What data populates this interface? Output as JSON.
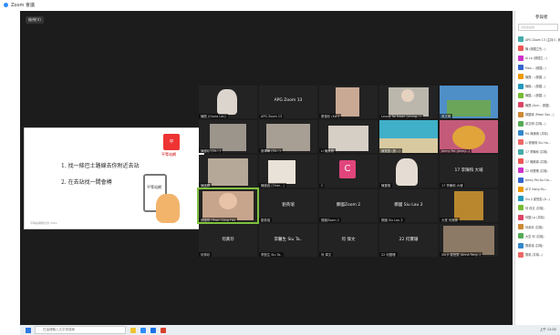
{
  "window": {
    "title": "Zoom 會議"
  },
  "meeting": {
    "view_button": "檢視(V)"
  },
  "share": {
    "lines": [
      "1. 找一條巴士路線去你附近去站",
      "2. 在去站找一間會樽"
    ],
    "logo_text": "平等站網",
    "phone_text": "平等站網",
    "footer": "平等站網聯合會 2022"
  },
  "tiles": [
    {
      "name": "陳觀 (Gloria Lau)",
      "label": ""
    },
    {
      "name": "APG Zoom 13",
      "label": "APG Zoom 13"
    },
    {
      "name": "蔡德珍 (Ka..)",
      "label": ""
    },
    {
      "name": "Leung Tai Kwan (Leung...)",
      "label": ""
    },
    {
      "name": "黃文明",
      "label": ""
    },
    {
      "name": "陳穗珍 (Ch...)",
      "label": ""
    },
    {
      "name": "鄭澤華 (Ch...)",
      "label": ""
    },
    {
      "name": "Li 陳美珠",
      "label": ""
    },
    {
      "name": "陳雪蓮 (麗...)",
      "label": ""
    },
    {
      "name": "Jenny Pal (Jenny...)",
      "label": ""
    },
    {
      "name": "陳國輝",
      "label": ""
    },
    {
      "name": "陳錦強 (Chan...)",
      "label": ""
    },
    {
      "name": "C",
      "label": "C"
    },
    {
      "name": "陳寶娟",
      "label": ""
    },
    {
      "name": "17 李陳和 大埔",
      "label": "17 李陳和 大埔"
    },
    {
      "name": "鄭國球 (Pawn Sang Ho)",
      "label": ""
    },
    {
      "name": "劉英瑞",
      "label": "劉英瑞"
    },
    {
      "name": "鄭國Zoom 2",
      "label": "鄭國Zoom 2"
    },
    {
      "name": "鄭國 Siu Lau 2",
      "label": "鄭國 Siu Lau 2"
    },
    {
      "name": "大堂 何美珠",
      "label": ""
    },
    {
      "name": "何黃珍",
      "label": "何黃珍"
    },
    {
      "name": "李醫生 Siu Ta..",
      "label": "李醫生 Siu Ta.."
    },
    {
      "name": "何 偉文",
      "label": "何 偉文"
    },
    {
      "name": "22 何寶珊",
      "label": "22 何寶珊"
    },
    {
      "name": "Siu Ji 梁慧雯 (Anna Tang..)",
      "label": ""
    }
  ],
  "panel": {
    "title": "參與者",
    "search_placeholder": "尋找參與者",
    "participants": [
      "APG Zoom 13 (主持人, 我)",
      "陳 (鄭國立先...)",
      "Ai Lo (鄭國立...)",
      "Man... (鄭國...)",
      "陳寶... (鄭國...)",
      "陳錦... (鄭國...)",
      "陳國... (鄭國...)",
      "陳寶 (Ann... 鄭國)",
      "鄭國球 (Pawn San...)",
      "黃文明 (共鳴...)",
      "ML 陳美珠 (共鳴)",
      "Li 鄭美珠 Siu Ha...",
      "17 李陳和 (共鳴)",
      "17 陳樂娟 (共鳴)",
      "22 何寶珊 (共鳴)",
      "Jenny Pal Siu Ha...",
      "ATZ Hong Siu...",
      "Siu Ji 梁慧雯 (A...)",
      "何 偉文 (共鳴)",
      "何國 Lo (共鳴)",
      "何黃珍 (共鳴)",
      "大堂 何 (共鳴)",
      "劉英瑞 (共鳴)",
      "劉英 (共鳴...)"
    ],
    "invite_label": "邀請",
    "mute_all_label": "全部"
  },
  "taskbar": {
    "search_placeholder": "在這裡輸入文字來搜尋",
    "clock": "上午 11:02"
  },
  "colors": {
    "meeting_bg": "#1c1c1c",
    "active_speaker": "#7ec13e",
    "zoom_blue": "#2d8cff"
  }
}
